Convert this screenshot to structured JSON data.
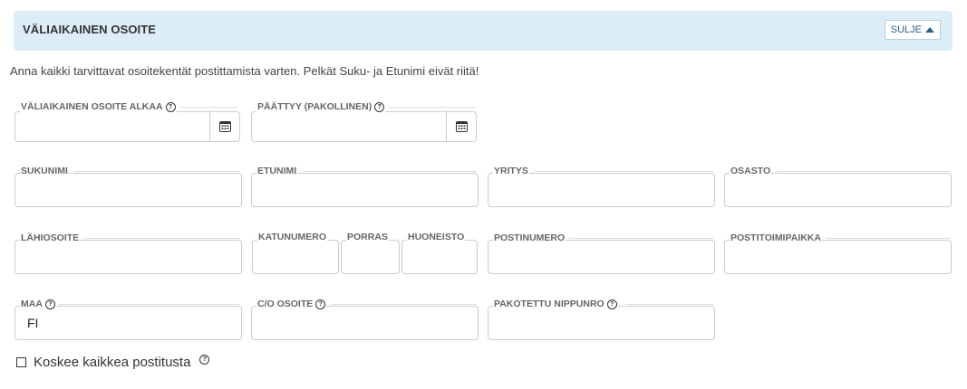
{
  "section": {
    "title": "VÄLIAIKAINEN OSOITE",
    "close_label": "SULJE"
  },
  "instruction": "Anna kaikki tarvittavat osoitekentät postittamista varten. Pelkät Suku- ja Etunimi eivät riitä!",
  "dates": {
    "start_label": "VÄLIAIKAINEN OSOITE ALKAA",
    "end_label": "PÄÄTTYY (PAKOLLINEN)"
  },
  "name_row": {
    "surname_label": "SUKUNIMI",
    "firstname_label": "ETUNIMI",
    "company_label": "YRITYS",
    "department_label": "OSASTO"
  },
  "address_row": {
    "street_label": "LÄHIOSOITE",
    "street_number_label": "KATUNUMERO",
    "stairway_label": "PORRAS",
    "apartment_label": "HUONEISTO",
    "postal_code_label": "POSTINUMERO",
    "city_label": "POSTITOIMIPAIKKA"
  },
  "country_row": {
    "country_label": "MAA",
    "country_value": "FI",
    "co_label": "C/O OSOITE",
    "bundle_label": "PAKOTETTU NIPPUNRO"
  },
  "checkbox": {
    "label": "Koskee kaikkea postitusta",
    "checked": false
  },
  "help_symbol": "?"
}
